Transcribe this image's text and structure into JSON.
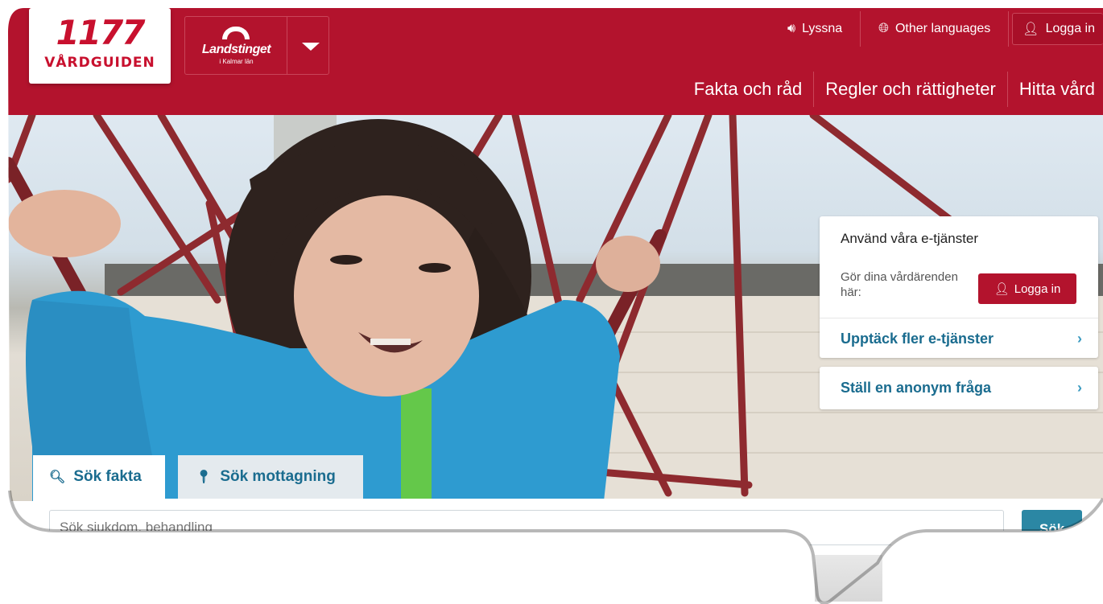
{
  "header": {
    "logo_number": "1177",
    "logo_name": "VÅRDGUIDEN",
    "landsting_name": "Landstinget",
    "landsting_region": "i Kalmar län",
    "top_links": {
      "listen": "Lyssna",
      "languages": "Other languages",
      "login": "Logga in"
    },
    "nav": [
      "Fakta och råd",
      "Regler och rättigheter",
      "Hitta vård"
    ]
  },
  "eservices": {
    "title": "Använd våra e-tjänster",
    "text": "Gör dina vårdärenden här:",
    "login": "Logga in",
    "link_more": "Upptäck fler e-tjänster",
    "link_question": "Ställ en anonym fråga"
  },
  "search": {
    "tab_facts": "Sök fakta",
    "tab_clinic": "Sök mottagning",
    "placeholder": "Sök sjukdom, behandling",
    "button": "Sök"
  },
  "colors": {
    "brand_red": "#b3132d",
    "link_blue": "#1a6c8f",
    "search_button": "#2b87a4"
  }
}
